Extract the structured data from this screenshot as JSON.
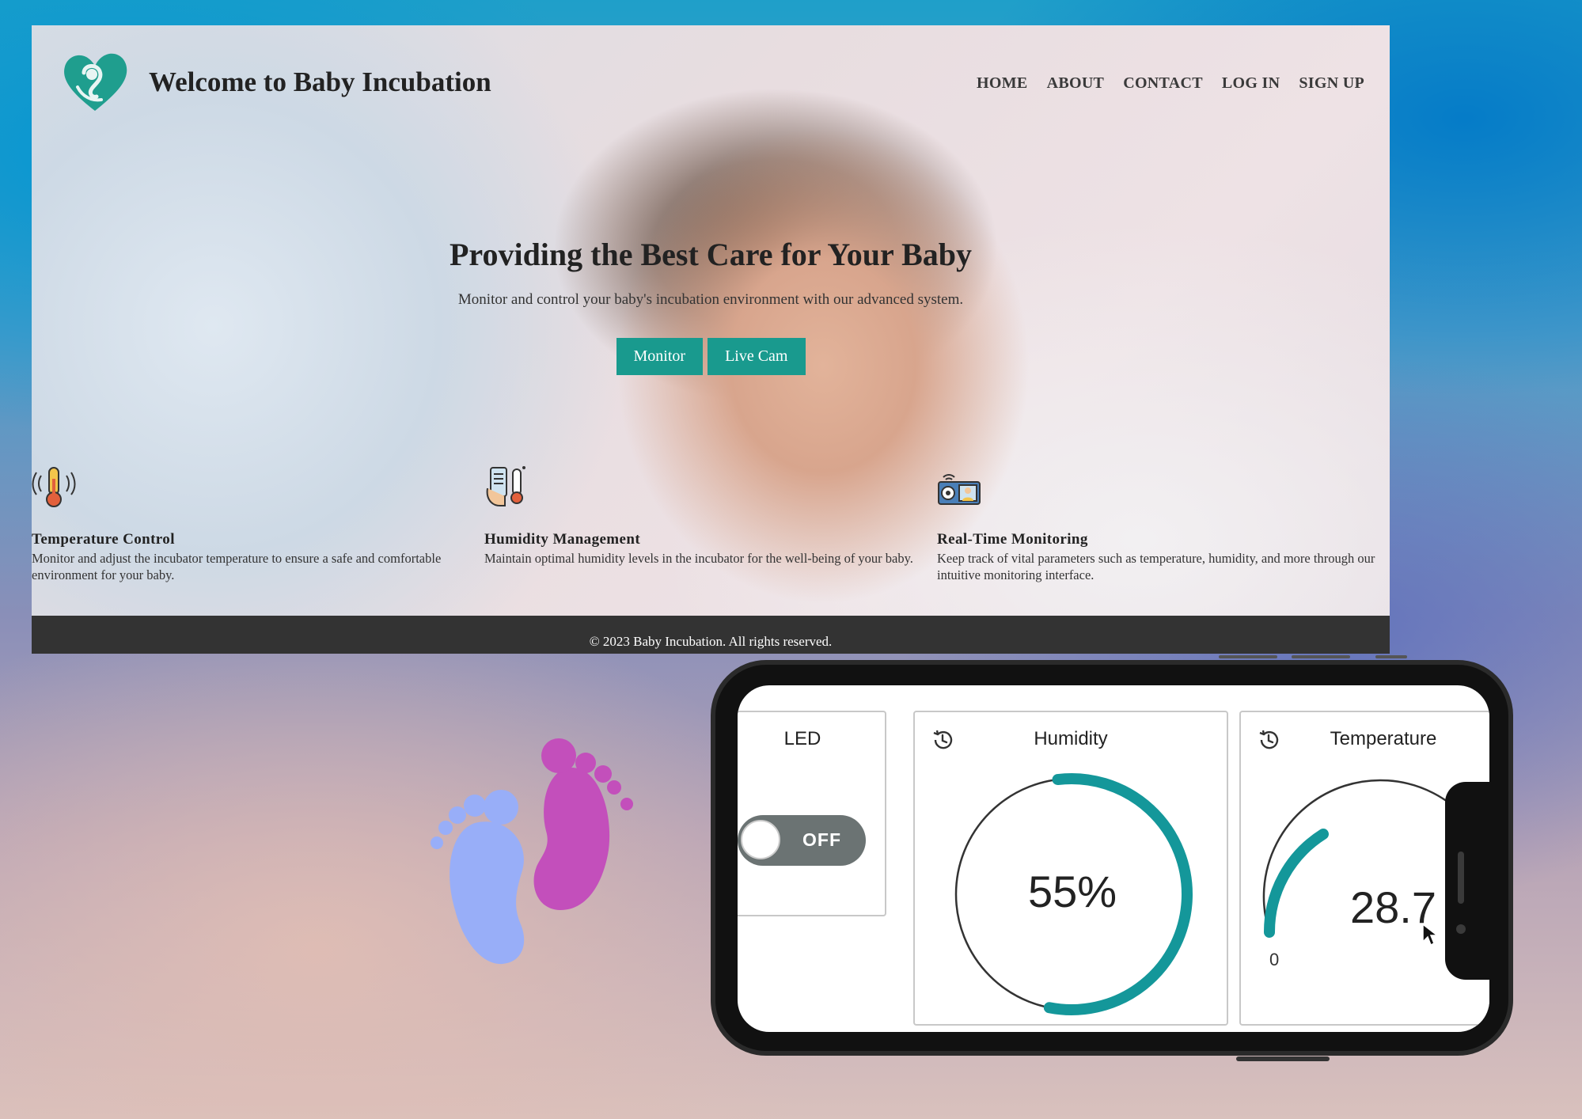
{
  "site": {
    "title": "Welcome to Baby Incubation",
    "nav": [
      "HOME",
      "ABOUT",
      "CONTACT",
      "LOG IN",
      "SIGN UP"
    ],
    "hero_title": "Providing the Best Care for Your Baby",
    "hero_subtitle": "Monitor and control your baby's incubation environment with our advanced system.",
    "buttons": {
      "monitor": "Monitor",
      "live_cam": "Live Cam"
    },
    "features": [
      {
        "icon": "thermometer-icon",
        "title": "Temperature Control",
        "text": "Monitor and adjust the incubator temperature to ensure a safe and comfortable environment for your baby."
      },
      {
        "icon": "humidity-icon",
        "title": "Humidity Management",
        "text": "Maintain optimal humidity levels in the incubator for the well-being of your baby."
      },
      {
        "icon": "monitoring-icon",
        "title": "Real-Time Monitoring",
        "text": "Keep track of vital parameters such as temperature, humidity, and more through our intuitive monitoring interface."
      }
    ],
    "footer": "© 2023 Baby Incubation. All rights reserved.",
    "accent_color": "#199a8e"
  },
  "dashboard": {
    "led": {
      "label": "LED",
      "state": "OFF"
    },
    "humidity": {
      "label": "Humidity",
      "value_text": "55%",
      "value": 55,
      "max": 100
    },
    "temperature": {
      "label": "Temperature",
      "value_text": "28.7",
      "min_label": "0"
    },
    "gauge_color": "#14979a"
  }
}
